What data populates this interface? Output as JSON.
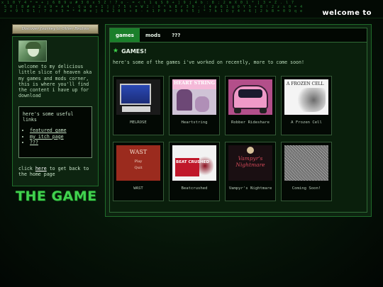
{
  "banner": {
    "rain": "x 1 0 Y 4 * = + j 6 B 9 u # 3 0 x 5 Z ! 7 o - = < t 1 q S 0 + ] 9 j 4 b : 8 ; 2 m X 0 1 * ] 3 = Z . l 7\n 5 0 [ 8 # e 2 x 9 = A 4 . Q u 0 + 1 ] j 7 5 t = W 2 : 0 * k 8 r 3 9 - ( 4 p 6 1 g 0 Y 5 + 8 ! 2 z s 0 = 4\n 2 + 9 l D 1 ; 7 0 x 3 = * 4 M e ] 6 u 2 0 5 + 8 - x 1 P 9 = 3 0 t 5 j * 7 k 1 O y 4 + 6 ] 2 b 8 = 0 9 q e",
    "welcome": "welcome to"
  },
  "sidebar": {
    "title_plate": "Discover Journey to Other Realms",
    "intro": "welcome to my delicious little slice of heaven aka my games and mods corner, this is where you'll find the content i have up for download",
    "links_heading": "here's some useful links",
    "links": [
      "featured game",
      "my itch page",
      "???"
    ],
    "back_prefix": "click ",
    "back_link": "here",
    "back_suffix": " to get back to the home page",
    "logo": "THE GAME"
  },
  "main": {
    "tabs": [
      {
        "label": "games",
        "active": true
      },
      {
        "label": "mods",
        "active": false
      },
      {
        "label": "???",
        "active": false
      }
    ],
    "heading": "GAMES!",
    "description": "here's some of the games i've worked on recently, more to come soon!",
    "games": [
      {
        "label": "MELROSE"
      },
      {
        "label": "Heartstring",
        "thumb_text": "HEART STRING"
      },
      {
        "label": "Robber Rideshare"
      },
      {
        "label": "A Frozen Cell",
        "thumb_text": "A FROZEN CELL"
      },
      {
        "label": "WAST",
        "thumb_title": "WAST",
        "thumb_menu": [
          "Play",
          "Quit"
        ]
      },
      {
        "label": "Beatcrushed",
        "thumb_text": "BEAT CRUSHED"
      },
      {
        "label": "Vampyr's Nightmare",
        "thumb_text": "Vampyr's Nightmare"
      },
      {
        "label": "Coming Soon!"
      }
    ]
  },
  "colors": {
    "accent": "#1a7f2a",
    "panel_border": "#1f6b2a",
    "logo_green": "#41d24e"
  }
}
